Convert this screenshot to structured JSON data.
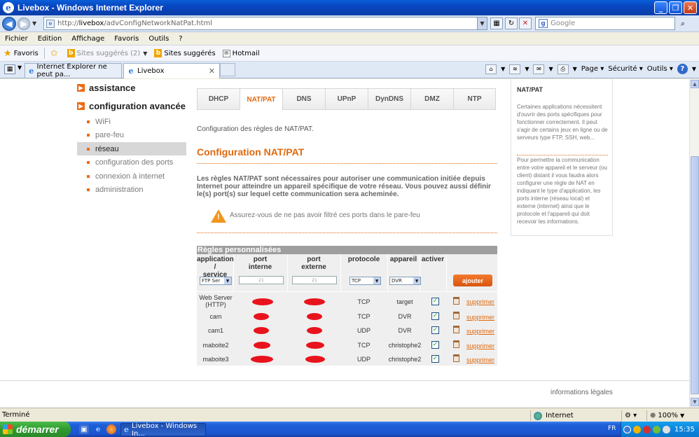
{
  "window": {
    "title": "Livebox - Windows Internet Explorer"
  },
  "address": {
    "url_prefix": "http://",
    "url_host": "livebox",
    "url_path": "/advConfigNetworkNatPat.html"
  },
  "search": {
    "placeholder": "Google"
  },
  "menu": [
    "Fichier",
    "Edition",
    "Affichage",
    "Favoris",
    "Outils",
    "?"
  ],
  "favbar": {
    "favorites": "Favoris",
    "suggested_grey": "Sites suggérés (2)",
    "suggested": "Sites suggérés",
    "hotmail": "Hotmail"
  },
  "tabs": [
    {
      "label": "Internet Explorer ne peut pa..."
    },
    {
      "label": "Livebox"
    }
  ],
  "cmdbar": {
    "page": "Page",
    "security": "Sécurité",
    "tools": "Outils"
  },
  "nav": {
    "assistance": "assistance",
    "advanced": "configuration avancée",
    "items": [
      "WiFi",
      "pare-feu",
      "réseau",
      "configuration des ports",
      "connexion à internet",
      "administration"
    ]
  },
  "subtabs": [
    "DHCP",
    "NAT/PAT",
    "DNS",
    "UPnP",
    "DynDNS",
    "DMZ",
    "NTP"
  ],
  "main": {
    "intro": "Configuration des règles de NAT/PAT.",
    "heading": "Configuration NAT/PAT",
    "description": "Les règles NAT/PAT sont nécessaires pour autoriser une communication initiée depuis Internet pour atteindre un appareil spécifique de votre réseau. Vous pouvez aussi définir le(s) port(s) sur lequel cette communication sera acheminée.",
    "warning": "Assurez-vous de ne pas avoir filtré ces ports dans le pare-feu"
  },
  "rules": {
    "title": "Règles personnalisées",
    "headers": {
      "app": [
        "application /",
        "service"
      ],
      "internal": [
        "port",
        "interne"
      ],
      "external": [
        "port",
        "externe"
      ],
      "protocol": "protocole",
      "device": "appareil",
      "enable": "activer"
    },
    "new_row": {
      "app": "FTP Ser",
      "internal": "21",
      "external": "21",
      "protocol": "TCP",
      "device": "DVR",
      "add": "ajouter"
    },
    "rows": [
      {
        "app": [
          "Web Server",
          "(HTTP)"
        ],
        "protocol": "TCP",
        "device": "target",
        "delete": "supprimer"
      },
      {
        "app": [
          "cam"
        ],
        "protocol": "TCP",
        "device": "DVR",
        "delete": "supprimer"
      },
      {
        "app": [
          "cam1"
        ],
        "protocol": "UDP",
        "device": "DVR",
        "delete": "supprimer"
      },
      {
        "app": [
          "maboite2"
        ],
        "protocol": "TCP",
        "device": "christophe2",
        "delete": "supprimer"
      },
      {
        "app": [
          "maboite3"
        ],
        "protocol": "UDP",
        "device": "christophe2",
        "delete": "supprimer"
      }
    ]
  },
  "help": {
    "title": "NAT/PAT",
    "p1": "Certaines applications nécessitent d'ouvrir des ports spécifiques pour fonctionner correctement. Il peut s'agir de certains jeux en ligne ou de serveurs type FTP, SSH, web...",
    "p2": "Pour permettre la communication entre votre appareil et le serveur (ou client) distant il vous faudra alors configurer une règle de NAT en indiquant le type d'application, les ports interne (réseau local) et externe (internet) ainsi que le protocole et l'appareil qui doit recevoir les informations."
  },
  "footer": {
    "legal": "informations légales"
  },
  "status": {
    "left": "Terminé",
    "zone": "Internet",
    "zoom": "100%"
  },
  "taskbar": {
    "start": "démarrer",
    "task": "Livebox - Windows In...",
    "lang": "FR",
    "clock": "15:35"
  },
  "colors": {
    "accent": "#e0690f",
    "xp_blue": "#0846c0"
  }
}
